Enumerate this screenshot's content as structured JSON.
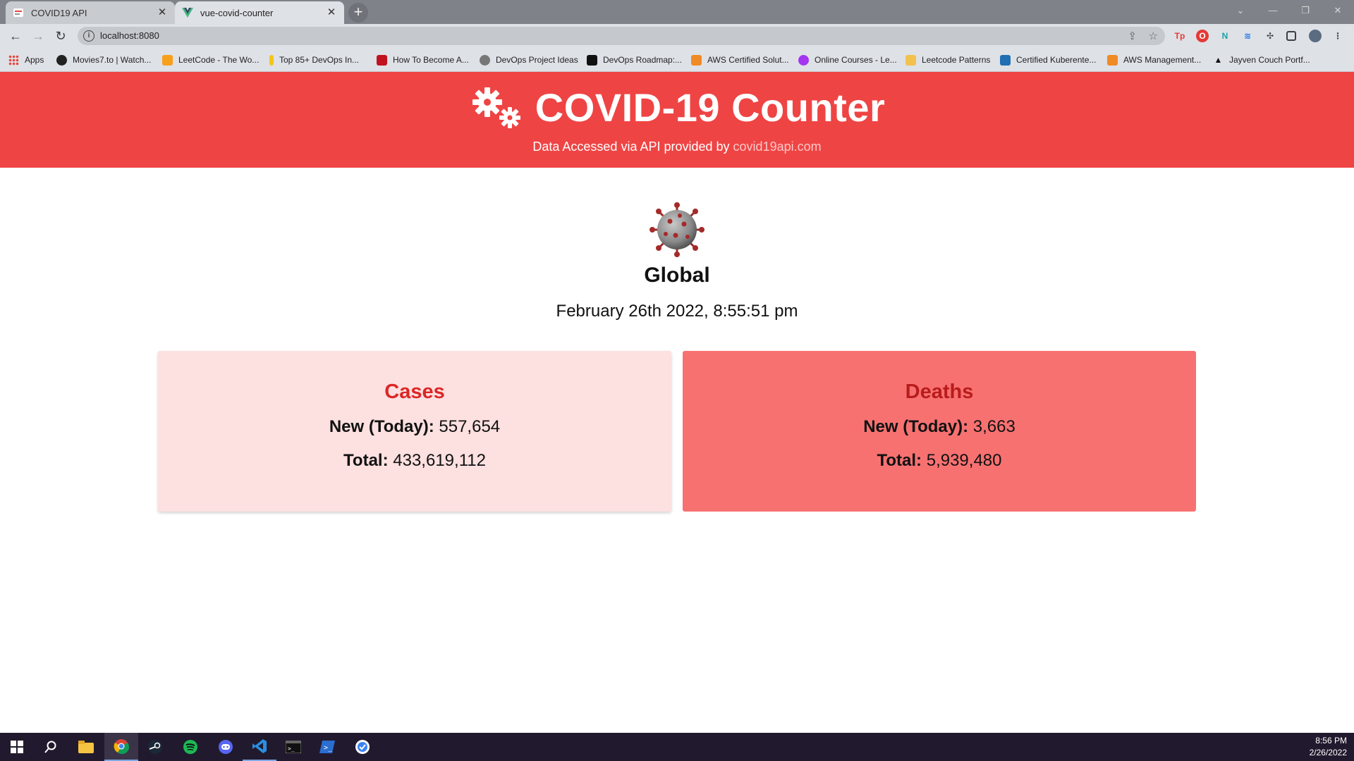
{
  "browser": {
    "tabs": [
      {
        "title": "COVID19 API",
        "active": false
      },
      {
        "title": "vue-covid-counter",
        "active": true
      }
    ],
    "new_tab": "+",
    "url": "localhost:8080",
    "bookmarks": [
      {
        "label": "Apps",
        "color": "#4285f4"
      },
      {
        "label": "Movies7.to | Watch...",
        "color": "#222222"
      },
      {
        "label": "LeetCode - The Wo...",
        "color": "#f89f1b"
      },
      {
        "label": "Top 85+ DevOps In...",
        "color": "#f5c518"
      },
      {
        "label": "How To Become A...",
        "color": "#c1121f"
      },
      {
        "label": "DevOps Project Ideas",
        "color": "#555555"
      },
      {
        "label": "DevOps Roadmap:...",
        "color": "#111111"
      },
      {
        "label": "AWS Certified Solut...",
        "color": "#f08a24"
      },
      {
        "label": "Online Courses - Le...",
        "color": "#a435f0"
      },
      {
        "label": "Leetcode Patterns",
        "color": "#f2c14e"
      },
      {
        "label": "Certified Kuberente...",
        "color": "#1f6fb2"
      },
      {
        "label": "AWS Management...",
        "color": "#f08a24"
      },
      {
        "label": "Jayven Couch Portf...",
        "color": "#111111"
      }
    ]
  },
  "header": {
    "title": "COVID-19 Counter",
    "subtitle_prefix": "Data Accessed via API provided by ",
    "subtitle_link": "covid19api.com",
    "bg_color": "#ef4444"
  },
  "summary": {
    "region": "Global",
    "timestamp": "February 26th 2022, 8:55:51 pm"
  },
  "cards": {
    "cases": {
      "title": "Cases",
      "new_label": "New (Today):",
      "new_value": "557,654",
      "total_label": "Total:",
      "total_value": "433,619,112"
    },
    "deaths": {
      "title": "Deaths",
      "new_label": "New (Today):",
      "new_value": "3,663",
      "total_label": "Total:",
      "total_value": "5,939,480"
    }
  },
  "taskbar": {
    "time": "8:56 PM",
    "date": "2/26/2022",
    "apps": [
      "start-icon",
      "search-icon",
      "file-explorer-icon",
      "chrome-icon",
      "steam-icon",
      "spotify-icon",
      "discord-icon",
      "vscode-icon",
      "terminal-icon",
      "powershell-icon",
      "app-icon"
    ]
  }
}
